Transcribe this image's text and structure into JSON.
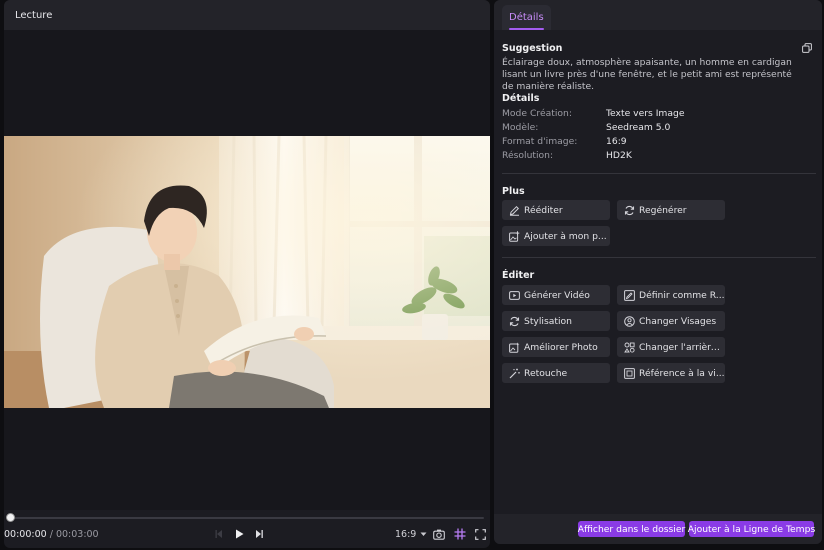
{
  "player": {
    "title": "Lecture",
    "current_time": "00:00:00",
    "separator": "/",
    "total_time": "00:03:00",
    "aspect_ratio": "16:9",
    "progress": 0
  },
  "details_panel": {
    "tab_label": "Détails",
    "suggestion": {
      "title": "Suggestion",
      "text": "Éclairage doux, atmosphère apaisante, un homme en cardigan lisant un livre près d'une fenêtre, et le petit ami est représenté de manière réaliste."
    },
    "details": {
      "title": "Détails",
      "rows": [
        {
          "label": "Mode Création:",
          "value": "Texte vers Image"
        },
        {
          "label": "Modèle:",
          "value": "Seedream 5.0"
        },
        {
          "label": "Format d'image:",
          "value": "16:9"
        },
        {
          "label": "Résolution:",
          "value": "HD2K"
        }
      ]
    },
    "plus": {
      "title": "Plus",
      "buttons": [
        {
          "label": "Rééditer",
          "icon": "pencil-icon"
        },
        {
          "label": "Regénérer",
          "icon": "refresh-icon"
        },
        {
          "label": "Ajouter à mon p...",
          "icon": "add-image-icon"
        }
      ]
    },
    "editer": {
      "title": "Éditer",
      "buttons": [
        {
          "label": "Générer Vidéo",
          "icon": "video-icon"
        },
        {
          "label": "Définir comme R...",
          "icon": "image-edit-icon"
        },
        {
          "label": "Stylisation",
          "icon": "refresh-icon"
        },
        {
          "label": "Changer Visages",
          "icon": "face-swap-icon"
        },
        {
          "label": "Améliorer Photo",
          "icon": "enhance-icon"
        },
        {
          "label": "Changer l'arrière...",
          "icon": "background-icon"
        },
        {
          "label": "Retouche",
          "icon": "magic-wand-icon"
        },
        {
          "label": "Référence à la vi...",
          "icon": "reference-icon"
        }
      ]
    },
    "footer": {
      "show_in_folder": "Afficher dans le dossier",
      "add_to_timeline": "Ajouter à la Ligne de Temps"
    }
  },
  "colors": {
    "accent": "#8a3be6",
    "tab_active_text": "#c78cf7",
    "panel_bg": "#1c1c22"
  }
}
